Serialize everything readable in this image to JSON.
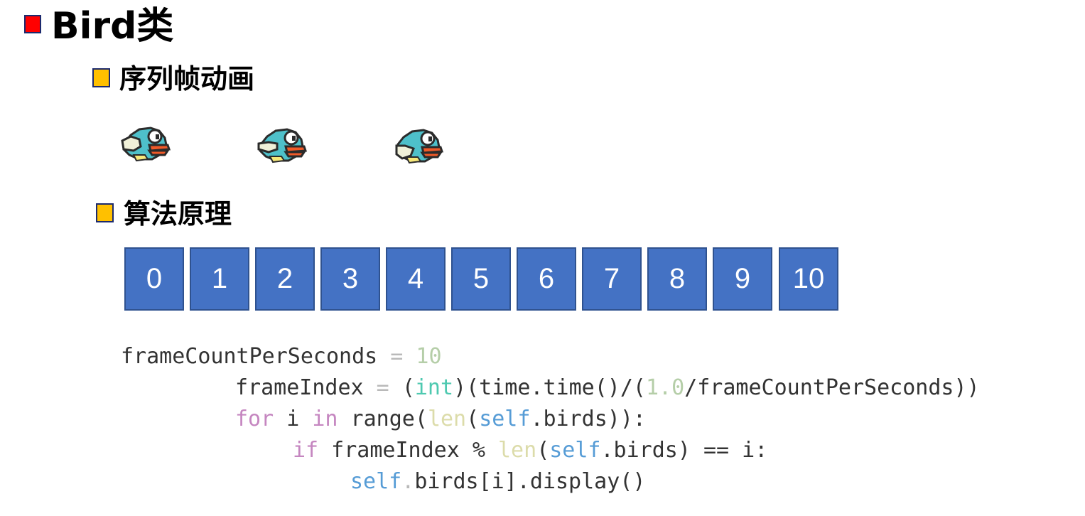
{
  "title": "Bird类",
  "section1": {
    "heading": "序列帧动画"
  },
  "birds": [
    {
      "name": "bird-frame-1"
    },
    {
      "name": "bird-frame-2"
    },
    {
      "name": "bird-frame-3"
    }
  ],
  "section2": {
    "heading": "算法原理"
  },
  "frames": [
    "0",
    "1",
    "2",
    "3",
    "4",
    "5",
    "6",
    "7",
    "8",
    "9",
    "10"
  ],
  "colors": {
    "title_bullet": "#ff0000",
    "sub_bullet": "#ffc000",
    "box_fill": "#4472c4",
    "bird_body": "#4ec0ca",
    "bird_beak": "#f05a28"
  },
  "code": {
    "line1": {
      "a": "frameCountPerSeconds",
      "b": " = ",
      "c": "10"
    },
    "line2": {
      "a": "frameIndex",
      "b": " = ",
      "c": "(",
      "d": "int",
      "e": ")(time.time()/(",
      "f": "1.0",
      "g": "/frameCountPerSeconds))"
    },
    "line3": {
      "a": "for",
      "b": " i ",
      "c": "in",
      "d": " range(",
      "e": "len",
      "f": "(",
      "g": "self",
      "h": ".birds)):"
    },
    "line4": {
      "a": "if",
      "b": " frameIndex % ",
      "c": "len",
      "d": "(",
      "e": "self",
      "f": ".birds) == i:"
    },
    "line5": {
      "a": "self",
      "b": ".",
      "c": "birds[i].display()"
    }
  }
}
